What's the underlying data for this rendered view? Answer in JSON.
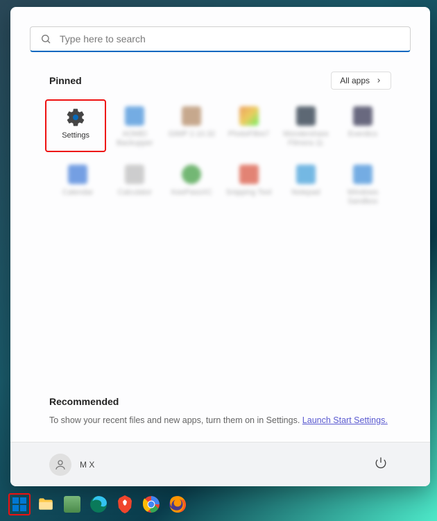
{
  "search": {
    "placeholder": "Type here to search"
  },
  "pinned": {
    "title": "Pinned",
    "allAppsLabel": "All apps",
    "tiles": [
      {
        "label": "Settings",
        "iconColor": "#505050"
      },
      {
        "label": "AOMEI Backupper",
        "iconColor": "#3b8bd8"
      },
      {
        "label": "GIMP 2.10.32",
        "iconColor": "#b0855e"
      },
      {
        "label": "PhotoFiltre7",
        "iconColor": "#e67a1e"
      },
      {
        "label": "Wondershare Filmora 11",
        "iconColor": "#1a2a3a"
      },
      {
        "label": "Everdics",
        "iconColor": "#2b2b4a"
      },
      {
        "label": "Calendar",
        "iconColor": "#3b78d8"
      },
      {
        "label": "Calculator",
        "iconColor": "#6a6a6a"
      },
      {
        "label": "KeePassXC",
        "iconColor": "#3a9a3a"
      },
      {
        "label": "Snipping Tool",
        "iconColor": "#d8503b"
      },
      {
        "label": "Notepad",
        "iconColor": "#3b9bd8"
      },
      {
        "label": "Windows Sandbox",
        "iconColor": "#3b8bd8"
      }
    ]
  },
  "recommended": {
    "title": "Recommended",
    "text": "To show your recent files and new apps, turn them on in Settings. ",
    "linkText": "Launch Start Settings."
  },
  "footer": {
    "userName": "M X"
  },
  "taskbar": {
    "items": [
      "start",
      "explorer",
      "photos",
      "edge",
      "brave",
      "chrome",
      "firefox"
    ]
  }
}
